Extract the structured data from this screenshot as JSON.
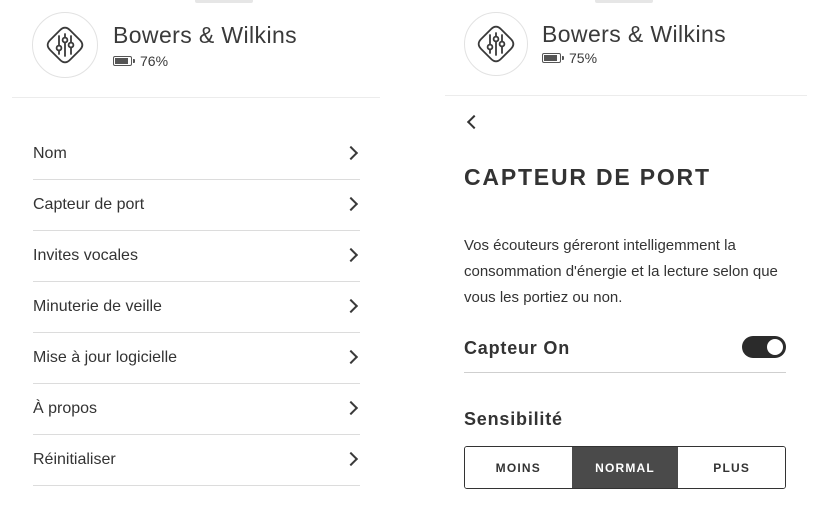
{
  "left_panel": {
    "device": {
      "name": "Bowers & Wilkins",
      "battery": "76%",
      "battery_level": 0.76,
      "logo_icon": "bw-logo-icon"
    },
    "menu": [
      {
        "label": "Nom"
      },
      {
        "label": "Capteur de port"
      },
      {
        "label": "Invites vocales"
      },
      {
        "label": "Minuterie de veille"
      },
      {
        "label": "Mise à jour logicielle"
      },
      {
        "label": "À propos"
      },
      {
        "label": "Réinitialiser"
      }
    ]
  },
  "right_panel": {
    "device": {
      "name": "Bowers & Wilkins",
      "battery": "75%",
      "battery_level": 0.75,
      "logo_icon": "bw-logo-icon"
    },
    "back_icon": "chevron-left-icon",
    "title": "CAPTEUR DE PORT",
    "description": "Vos écouteurs géreront intelligemment la consommation d'énergie et la lecture selon que vous les portiez ou non.",
    "toggle": {
      "label": "Capteur On",
      "on": true
    },
    "sensitivity": {
      "label": "Sensibilité",
      "options": [
        "MOINS",
        "NORMAL",
        "PLUS"
      ],
      "selected": "NORMAL"
    }
  },
  "colors": {
    "text": "#333333",
    "selected_segment": "#4a4a4a",
    "toggle_on": "#2b2b2b",
    "divider": "#dcdcdc"
  }
}
